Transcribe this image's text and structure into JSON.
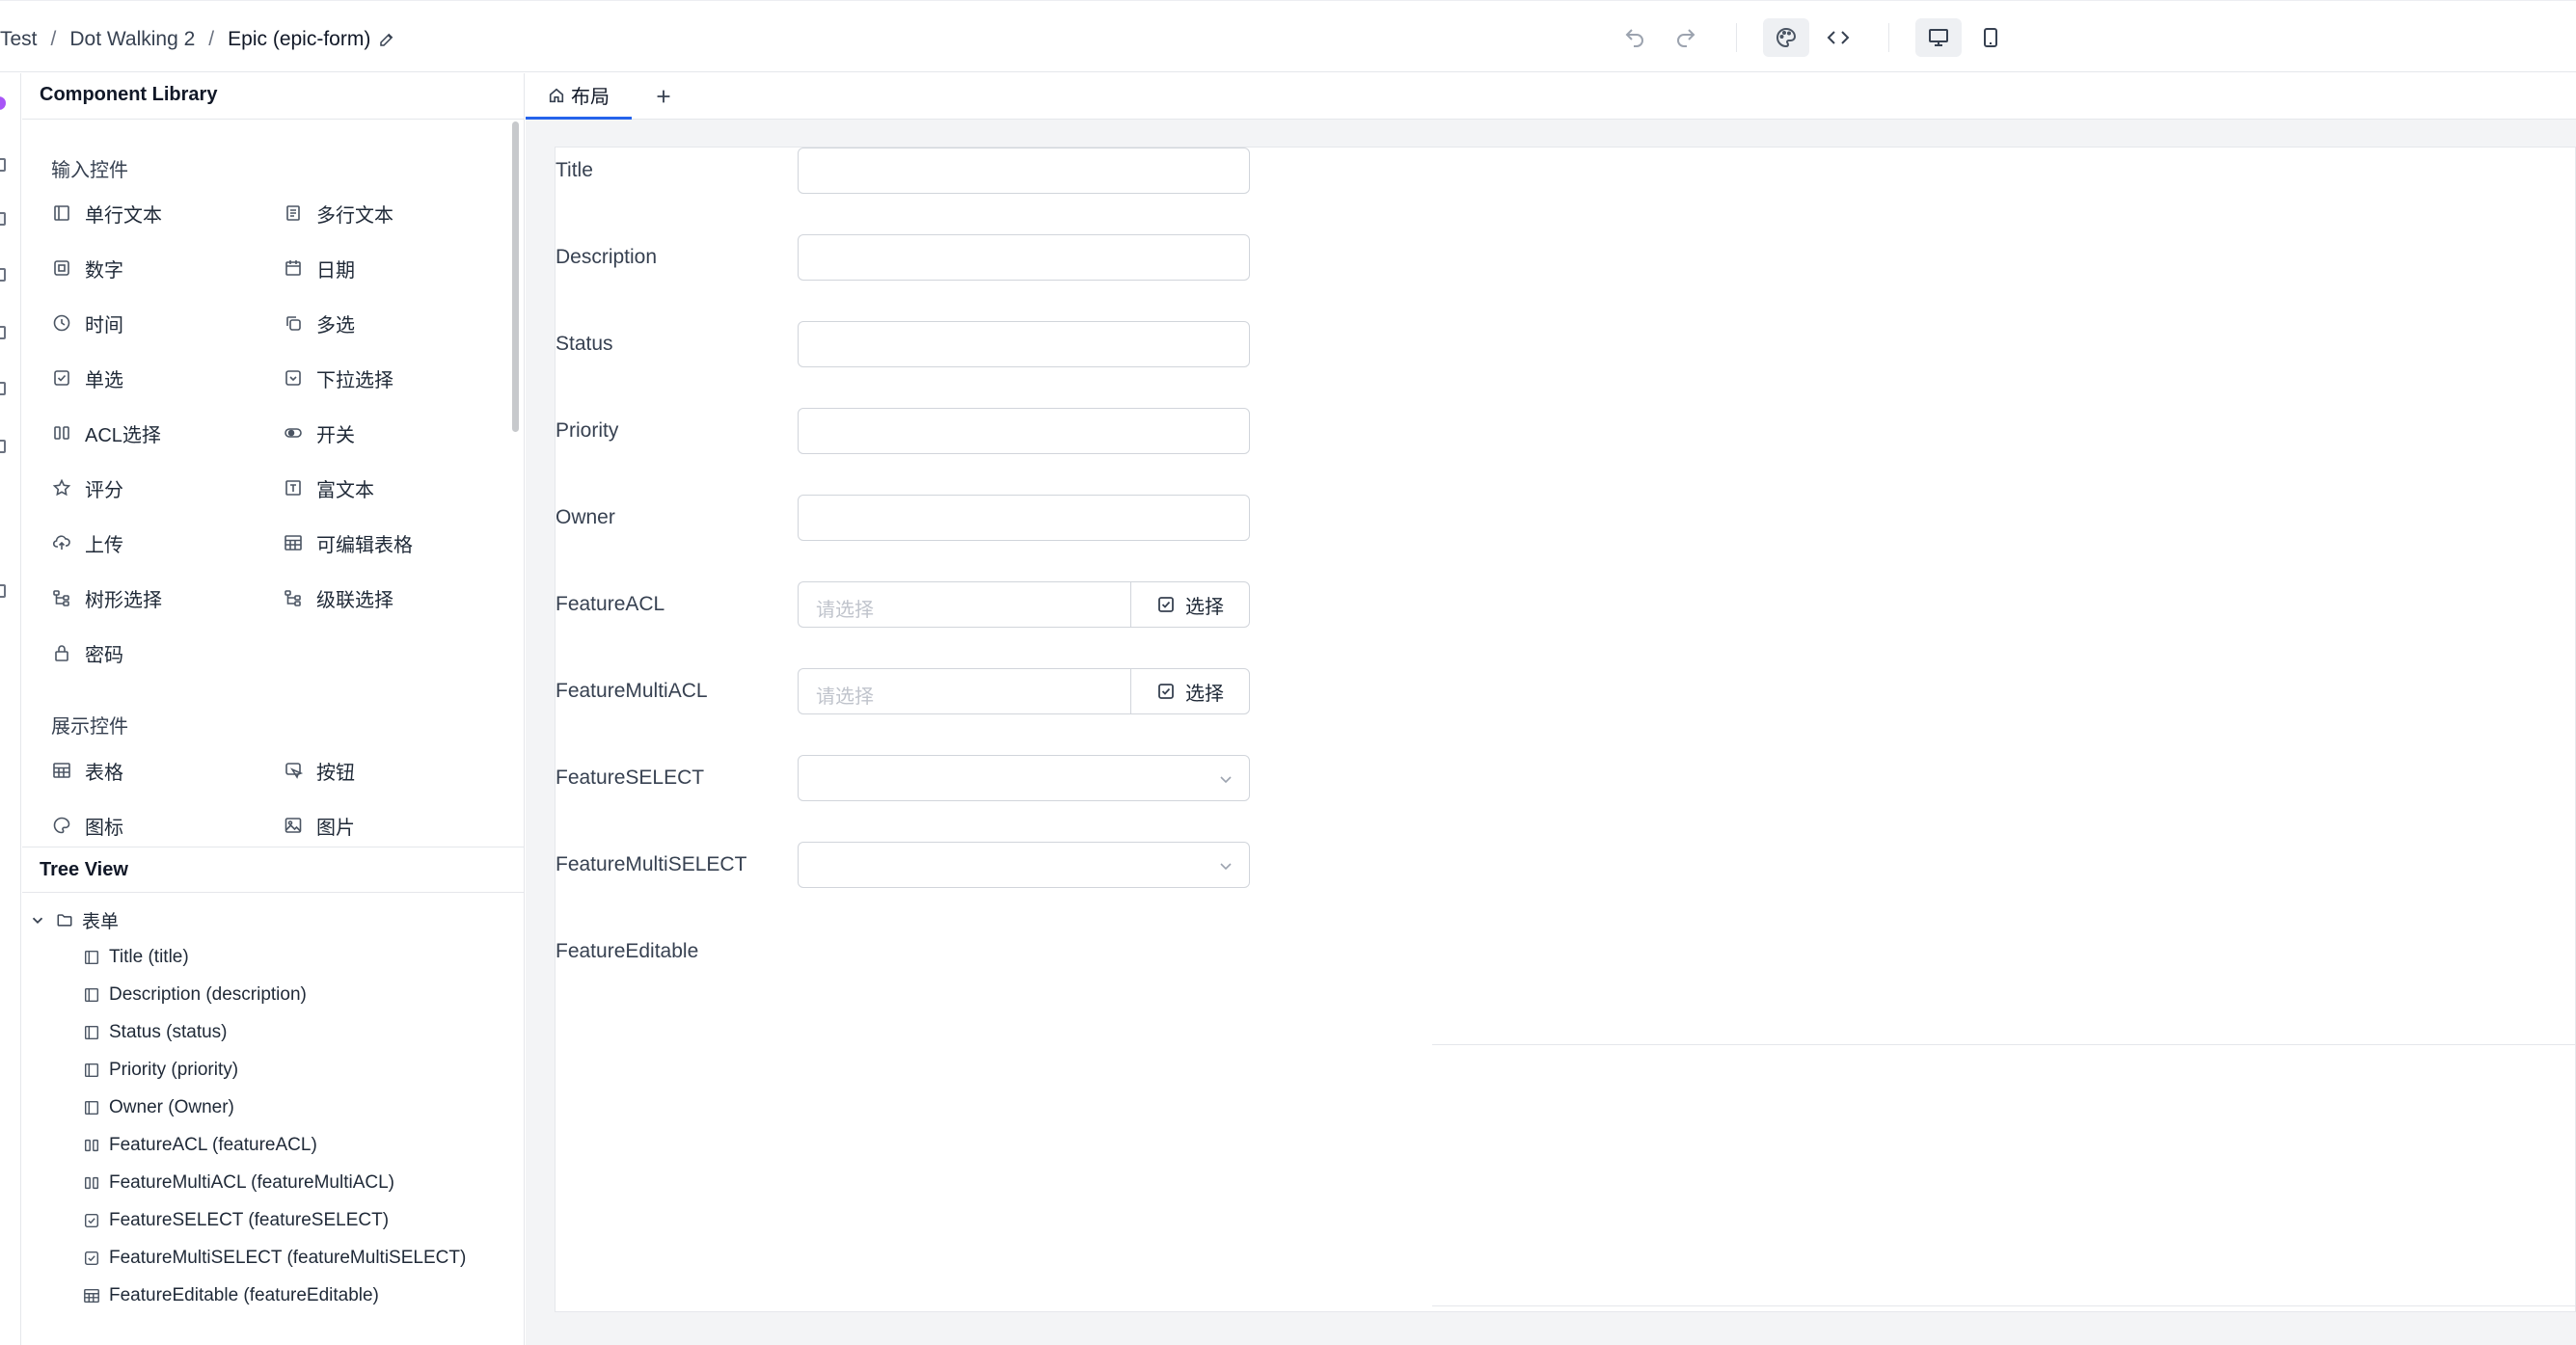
{
  "breadcrumb": {
    "items": [
      "Test",
      "Dot Walking 2",
      "Epic (epic-form)"
    ],
    "edit_icon": "pencil-icon"
  },
  "toolbar": {
    "icons": [
      "undo-icon",
      "redo-icon",
      "palette-icon",
      "code-icon",
      "desktop-icon",
      "mobile-icon"
    ]
  },
  "component_library": {
    "title": "Component Library",
    "input_section": "输入控件",
    "input_items": [
      {
        "label": "单行文本",
        "icon": "single-line-icon"
      },
      {
        "label": "多行文本",
        "icon": "multi-line-icon"
      },
      {
        "label": "数字",
        "icon": "number-icon"
      },
      {
        "label": "日期",
        "icon": "calendar-icon"
      },
      {
        "label": "时间",
        "icon": "clock-icon"
      },
      {
        "label": "多选",
        "icon": "copy-icon"
      },
      {
        "label": "单选",
        "icon": "checkbox-icon"
      },
      {
        "label": "下拉选择",
        "icon": "select-icon"
      },
      {
        "label": "ACL选择",
        "icon": "acl-icon"
      },
      {
        "label": "开关",
        "icon": "toggle-icon"
      },
      {
        "label": "评分",
        "icon": "star-icon"
      },
      {
        "label": "富文本",
        "icon": "rich-text-icon"
      },
      {
        "label": "上传",
        "icon": "upload-icon"
      },
      {
        "label": "可编辑表格",
        "icon": "table-icon"
      },
      {
        "label": "树形选择",
        "icon": "tree-icon"
      },
      {
        "label": "级联选择",
        "icon": "cascade-icon"
      },
      {
        "label": "密码",
        "icon": "lock-icon"
      }
    ],
    "display_section": "展示控件",
    "display_items": [
      {
        "label": "表格",
        "icon": "table-icon"
      },
      {
        "label": "按钮",
        "icon": "button-icon"
      },
      {
        "label": "图标",
        "icon": "palette-icon"
      },
      {
        "label": "图片",
        "icon": "image-icon"
      }
    ]
  },
  "tree_view": {
    "title": "Tree View",
    "root": "表单",
    "items": [
      {
        "label": "Title (title)",
        "icon": "input-icon"
      },
      {
        "label": "Description (description)",
        "icon": "input-icon"
      },
      {
        "label": "Status (status)",
        "icon": "input-icon"
      },
      {
        "label": "Priority (priority)",
        "icon": "input-icon"
      },
      {
        "label": "Owner (Owner)",
        "icon": "input-icon"
      },
      {
        "label": "FeatureACL (featureACL)",
        "icon": "acl-icon"
      },
      {
        "label": "FeatureMultiACL (featureMultiACL)",
        "icon": "acl-icon"
      },
      {
        "label": "FeatureSELECT (featureSELECT)",
        "icon": "select-icon"
      },
      {
        "label": "FeatureMultiSELECT (featureMultiSELECT)",
        "icon": "select-icon"
      },
      {
        "label": "FeatureEditable (featureEditable)",
        "icon": "table-icon"
      }
    ]
  },
  "tabs": {
    "active": "布局",
    "add_icon": "plus-icon"
  },
  "form": {
    "fields": [
      {
        "label": "Title",
        "type": "text"
      },
      {
        "label": "Description",
        "type": "text"
      },
      {
        "label": "Status",
        "type": "text"
      },
      {
        "label": "Priority",
        "type": "text"
      },
      {
        "label": "Owner",
        "type": "text"
      },
      {
        "label": "FeatureACL",
        "type": "acl",
        "placeholder": "请选择",
        "button": "选择"
      },
      {
        "label": "FeatureMultiACL",
        "type": "acl",
        "placeholder": "请选择",
        "button": "选择"
      },
      {
        "label": "FeatureSELECT",
        "type": "select"
      },
      {
        "label": "FeatureMultiSELECT",
        "type": "select"
      },
      {
        "label": "FeatureEditable",
        "type": "editable"
      }
    ]
  },
  "colors": {
    "accent": "#2563eb",
    "rail_dot": "#a855f7"
  }
}
